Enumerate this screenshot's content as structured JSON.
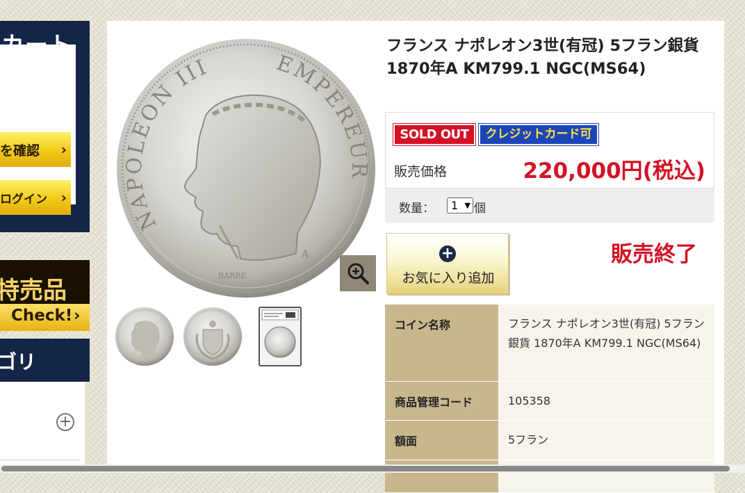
{
  "sidebar": {
    "cart_title": "カート",
    "confirm_button": "を確認",
    "login_button": "ログイン",
    "chevron": "›",
    "sale_banner_text": "特売品",
    "sale_check_label": "Check!",
    "category_title": "ゴリ",
    "expand_symbol": "+"
  },
  "product": {
    "title": "フランス ナポレオン3世(有冠) 5フラン銀貨 1870年A KM799.1 NGC(MS64)",
    "badges": {
      "sold_out": "SOLD OUT",
      "credit": "クレジットカード可"
    },
    "price_label": "販売価格",
    "price": "220,000円(税込)",
    "quantity_label": "数量：",
    "quantity_value": "1",
    "quantity_unit": "個",
    "favorite_plus": "+",
    "favorite_button": "お気に入り追加",
    "status": "販売終了",
    "coin_legend": {
      "left": "NAPOLEON III",
      "right": "EMPEREUR",
      "engraver": "BARRE",
      "mint": "A"
    }
  },
  "specs": [
    {
      "key": "コイン名称",
      "value": "フランス ナポレオン3世(有冠) 5フラン銀貨 1870年A KM799.1 NGC(MS64)"
    },
    {
      "key": "商品管理コード",
      "value": "105358"
    },
    {
      "key": "額面",
      "value": "5フラン"
    },
    {
      "key": "",
      "value": ""
    }
  ],
  "icons": {
    "zoom": "zoom-in-icon",
    "plus": "plus-circle-icon",
    "chevron": "chevron-right-icon"
  },
  "colors": {
    "navy": "#152548",
    "gold": "#f2c917",
    "sold_red": "#d41226",
    "credit_blue": "#1c46b8",
    "spec_key_bg": "#c8b78d",
    "spec_value_bg": "#f7f4ec"
  }
}
